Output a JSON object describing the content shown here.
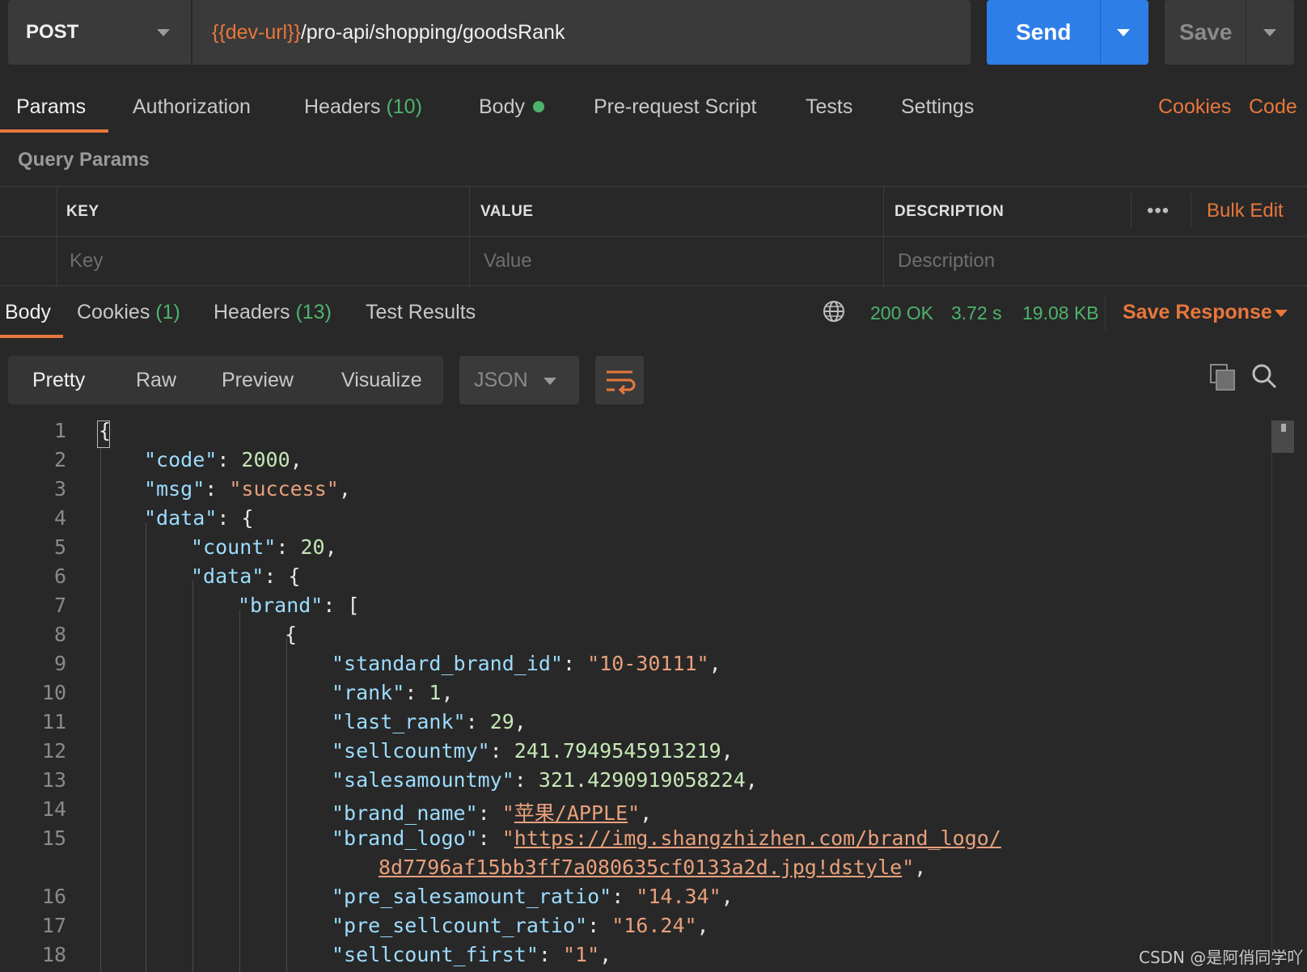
{
  "request": {
    "method": "POST",
    "url_var": "{{dev-url}}",
    "url_path": "/pro-api/shopping/goodsRank",
    "send_label": "Send",
    "save_label": "Save"
  },
  "request_tabs": {
    "params": "Params",
    "authorization": "Authorization",
    "headers": "Headers",
    "headers_count": "(10)",
    "body": "Body",
    "prerequest": "Pre-request Script",
    "tests": "Tests",
    "settings": "Settings",
    "cookies": "Cookies",
    "code": "Code"
  },
  "query_params": {
    "title": "Query Params",
    "col_key": "KEY",
    "col_value": "VALUE",
    "col_description": "DESCRIPTION",
    "more": "•••",
    "bulk_edit": "Bulk Edit",
    "key_placeholder": "Key",
    "value_placeholder": "Value",
    "description_placeholder": "Description"
  },
  "response_tabs": {
    "body": "Body",
    "cookies": "Cookies",
    "cookies_count": "(1)",
    "headers": "Headers",
    "headers_count": "(13)",
    "test_results": "Test Results",
    "status": "200 OK",
    "time": "3.72 s",
    "size": "19.08 KB",
    "save_response": "Save Response"
  },
  "view": {
    "pretty": "Pretty",
    "raw": "Raw",
    "preview": "Preview",
    "visualize": "Visualize",
    "format": "JSON"
  },
  "code_lines": {
    "l1": "{",
    "l2_k": "\"code\"",
    "l2_v": "2000",
    "l3_k": "\"msg\"",
    "l3_v": "\"success\"",
    "l4_k": "\"data\"",
    "l5_k": "\"count\"",
    "l5_v": "20",
    "l6_k": "\"data\"",
    "l7_k": "\"brand\"",
    "l8": "{",
    "l9_k": "\"standard_brand_id\"",
    "l9_v": "\"10-30111\"",
    "l10_k": "\"rank\"",
    "l10_v": "1",
    "l11_k": "\"last_rank\"",
    "l11_v": "29",
    "l12_k": "\"sellcountmy\"",
    "l12_v": "241.7949545913219",
    "l13_k": "\"salesamountmy\"",
    "l13_v": "321.4290919058224",
    "l14_k": "\"brand_name\"",
    "l14_v": "苹果/APPLE",
    "l15_k": "\"brand_logo\"",
    "l15_v1": "https://img.shangzhizhen.com/brand_logo/",
    "l15_v2": "8d7796af15bb3ff7a080635cf0133a2d.jpg!dstyle",
    "l16_k": "\"pre_salesamount_ratio\"",
    "l16_v": "\"14.34\"",
    "l17_k": "\"pre_sellcount_ratio\"",
    "l17_v": "\"16.24\"",
    "l18_k": "\"sellcount_first\"",
    "l18_v": "\"1\""
  },
  "line_numbers": [
    "1",
    "2",
    "3",
    "4",
    "5",
    "6",
    "7",
    "8",
    "9",
    "10",
    "11",
    "12",
    "13",
    "14",
    "15",
    "16",
    "17",
    "18"
  ],
  "watermark": "CSDN @是阿俏同学吖",
  "colors": {
    "accent": "#e8773c",
    "send_blue": "#2d7ee6",
    "status_green": "#4db36b",
    "background": "#282828"
  }
}
